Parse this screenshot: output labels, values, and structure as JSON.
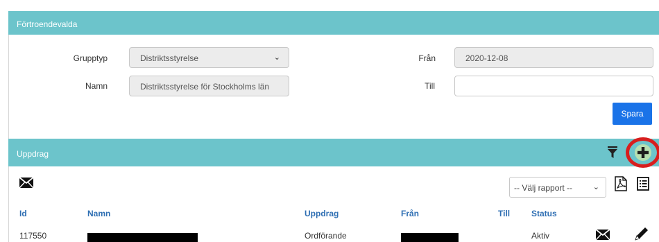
{
  "panel1": {
    "title": "Förtroendevalda"
  },
  "form": {
    "grupptyp_label": "Grupptyp",
    "grupptyp_value": "Distriktsstyrelse",
    "namn_label": "Namn",
    "namn_value": "Distriktsstyrelse för Stockholms län",
    "fran_label": "Från",
    "fran_value": "2020-12-08",
    "till_label": "Till",
    "till_value": "",
    "save_label": "Spara"
  },
  "panel2": {
    "title": "Uppdrag"
  },
  "report": {
    "selected": "-- Välj rapport --"
  },
  "table": {
    "headers": {
      "id": "Id",
      "namn": "Namn",
      "uppdrag": "Uppdrag",
      "fran": "Från",
      "till": "Till",
      "status": "Status"
    },
    "rows": [
      {
        "id": "117550",
        "namn": "",
        "uppdrag": "Ordförande",
        "fran": "",
        "till": "",
        "status": "Aktiv"
      }
    ]
  },
  "colors": {
    "header_bg": "#6cc4cb",
    "primary": "#1a73e8",
    "link": "#2f6fb3",
    "highlight_ring": "#d81e1e"
  },
  "icons": [
    "filter-icon",
    "plus-icon",
    "envelope-icon",
    "pdf-icon",
    "list-icon",
    "pencil-icon"
  ]
}
